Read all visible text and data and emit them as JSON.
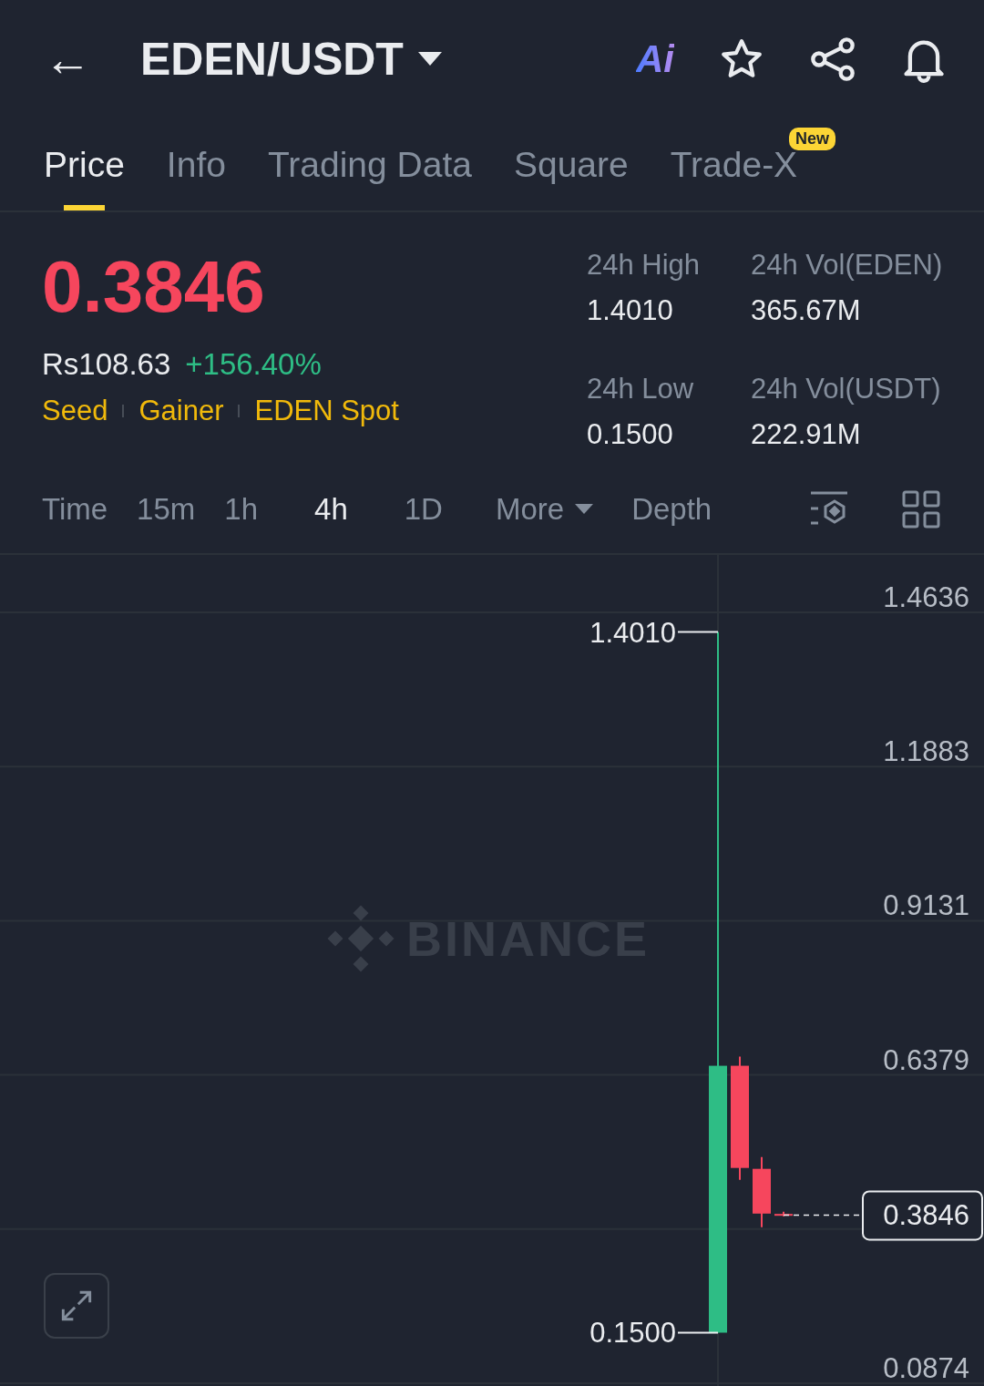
{
  "header": {
    "back": "←",
    "title": "EDEN/USDT",
    "ai_label": "Ai"
  },
  "tabs": [
    {
      "label": "Price",
      "selected": true
    },
    {
      "label": "Info",
      "selected": false
    },
    {
      "label": "Trading Data",
      "selected": false
    },
    {
      "label": "Square",
      "selected": false
    },
    {
      "label": "Trade-X",
      "selected": false,
      "badge": "New"
    }
  ],
  "summary": {
    "price": "0.3846",
    "fiat": "Rs108.63",
    "change": "+156.40%",
    "tags": [
      "Seed",
      "Gainer",
      "EDEN Spot"
    ],
    "stats": [
      {
        "label": "24h High",
        "value": "1.4010"
      },
      {
        "label": "24h Vol(EDEN)",
        "value": "365.67M"
      },
      {
        "label": "24h Low",
        "value": "0.1500"
      },
      {
        "label": "24h Vol(USDT)",
        "value": "222.91M"
      }
    ]
  },
  "intervals": [
    {
      "label": "Time",
      "selected": false,
      "kind": "plain"
    },
    {
      "label": "15m",
      "selected": false,
      "kind": "plain"
    },
    {
      "label": "1h",
      "selected": false,
      "kind": "plain"
    },
    {
      "label": "4h",
      "selected": true,
      "kind": "plain"
    },
    {
      "label": "1D",
      "selected": false,
      "kind": "plain"
    },
    {
      "label": "More",
      "selected": false,
      "kind": "dropdown"
    },
    {
      "label": "Depth",
      "selected": false,
      "kind": "plain"
    }
  ],
  "chart": {
    "watermark": "BINANCE",
    "axis_labels": [
      "1.4636",
      "1.1883",
      "0.9131",
      "0.6379",
      "0.0874"
    ],
    "high_label": "1.4010",
    "low_label": "0.1500",
    "last_price_label": "0.3846"
  }
}
